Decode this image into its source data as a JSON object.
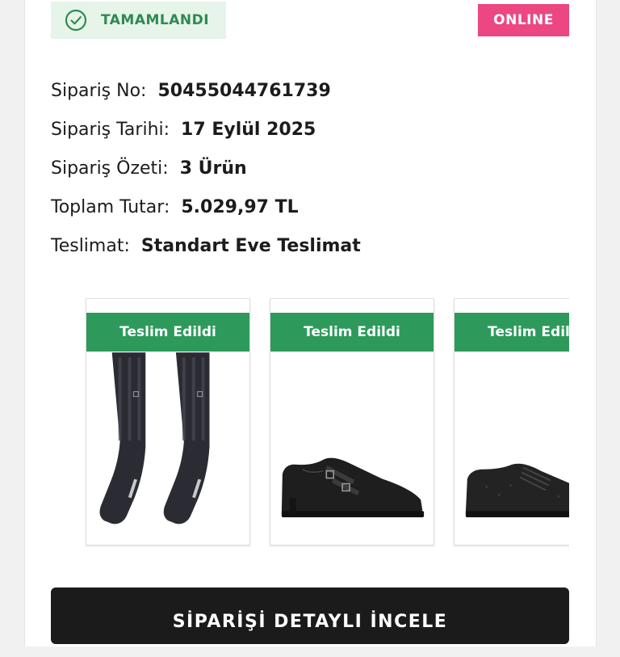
{
  "order": {
    "status": "TAMAMLANDI",
    "channel": "ONLINE",
    "details": [
      {
        "label": "Sipariş No:",
        "value": "50455044761739"
      },
      {
        "label": "Sipariş Tarihi:",
        "value": "17 Eylül 2025"
      },
      {
        "label": "Sipariş Özeti:",
        "value": "3 Ürün"
      },
      {
        "label": "Toplam Tutar:",
        "value": "5.029,97 TL"
      },
      {
        "label": "Teslimat:",
        "value": "Standart Eve Teslimat"
      }
    ]
  },
  "products": [
    {
      "status": "Teslim Edildi",
      "image": "sock-pair"
    },
    {
      "status": "Teslim Edildi",
      "image": "monk-strap-shoe"
    },
    {
      "status": "Teslim Edildi",
      "image": "derby-shoe"
    }
  ],
  "cta": {
    "label": "SİPARİŞİ DETAYLI İNCELE"
  },
  "colors": {
    "status_bg": "#e6f4ea",
    "status_text": "#2f8a52",
    "channel_bg": "#ec4683",
    "delivered_bg": "#2d9a5b",
    "cta_bg": "#1b1b1b"
  }
}
